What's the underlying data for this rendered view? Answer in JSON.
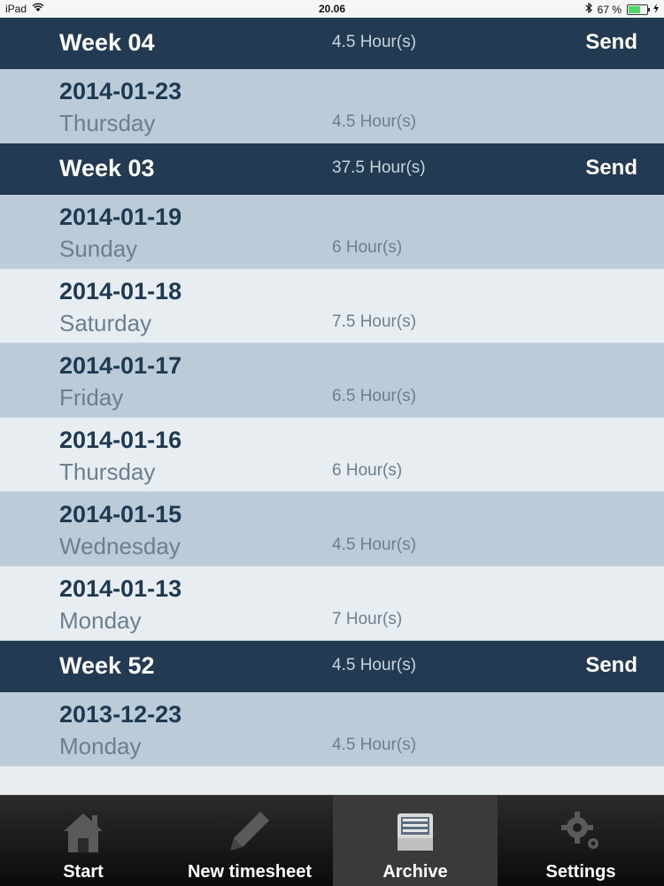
{
  "status": {
    "device": "iPad",
    "time": "20.06",
    "battery": "67 %",
    "battery_level": 0.67
  },
  "groups": [
    {
      "week": "Week 04",
      "total": "4.5 Hour(s)",
      "send_label": "Send",
      "days": [
        {
          "date": "2014-01-23",
          "weekday": "Thursday",
          "hours": "4.5 Hour(s)",
          "shade": "dark"
        }
      ]
    },
    {
      "week": "Week 03",
      "total": "37.5 Hour(s)",
      "send_label": "Send",
      "days": [
        {
          "date": "2014-01-19",
          "weekday": "Sunday",
          "hours": "6 Hour(s)",
          "shade": "dark"
        },
        {
          "date": "2014-01-18",
          "weekday": "Saturday",
          "hours": "7.5 Hour(s)",
          "shade": "light"
        },
        {
          "date": "2014-01-17",
          "weekday": "Friday",
          "hours": "6.5 Hour(s)",
          "shade": "dark"
        },
        {
          "date": "2014-01-16",
          "weekday": "Thursday",
          "hours": "6 Hour(s)",
          "shade": "light"
        },
        {
          "date": "2014-01-15",
          "weekday": "Wednesday",
          "hours": "4.5 Hour(s)",
          "shade": "dark"
        },
        {
          "date": "2014-01-13",
          "weekday": "Monday",
          "hours": "7 Hour(s)",
          "shade": "light"
        }
      ]
    },
    {
      "week": "Week 52",
      "total": "4.5 Hour(s)",
      "send_label": "Send",
      "days": [
        {
          "date": "2013-12-23",
          "weekday": "Monday",
          "hours": "4.5 Hour(s)",
          "shade": "dark"
        }
      ]
    }
  ],
  "tabs": [
    {
      "label": "Start",
      "icon": "home-icon",
      "active": false
    },
    {
      "label": "New timesheet",
      "icon": "pencil-icon",
      "active": false
    },
    {
      "label": "Archive",
      "icon": "archive-tray-icon",
      "active": true
    },
    {
      "label": "Settings",
      "icon": "gears-icon",
      "active": false
    }
  ]
}
